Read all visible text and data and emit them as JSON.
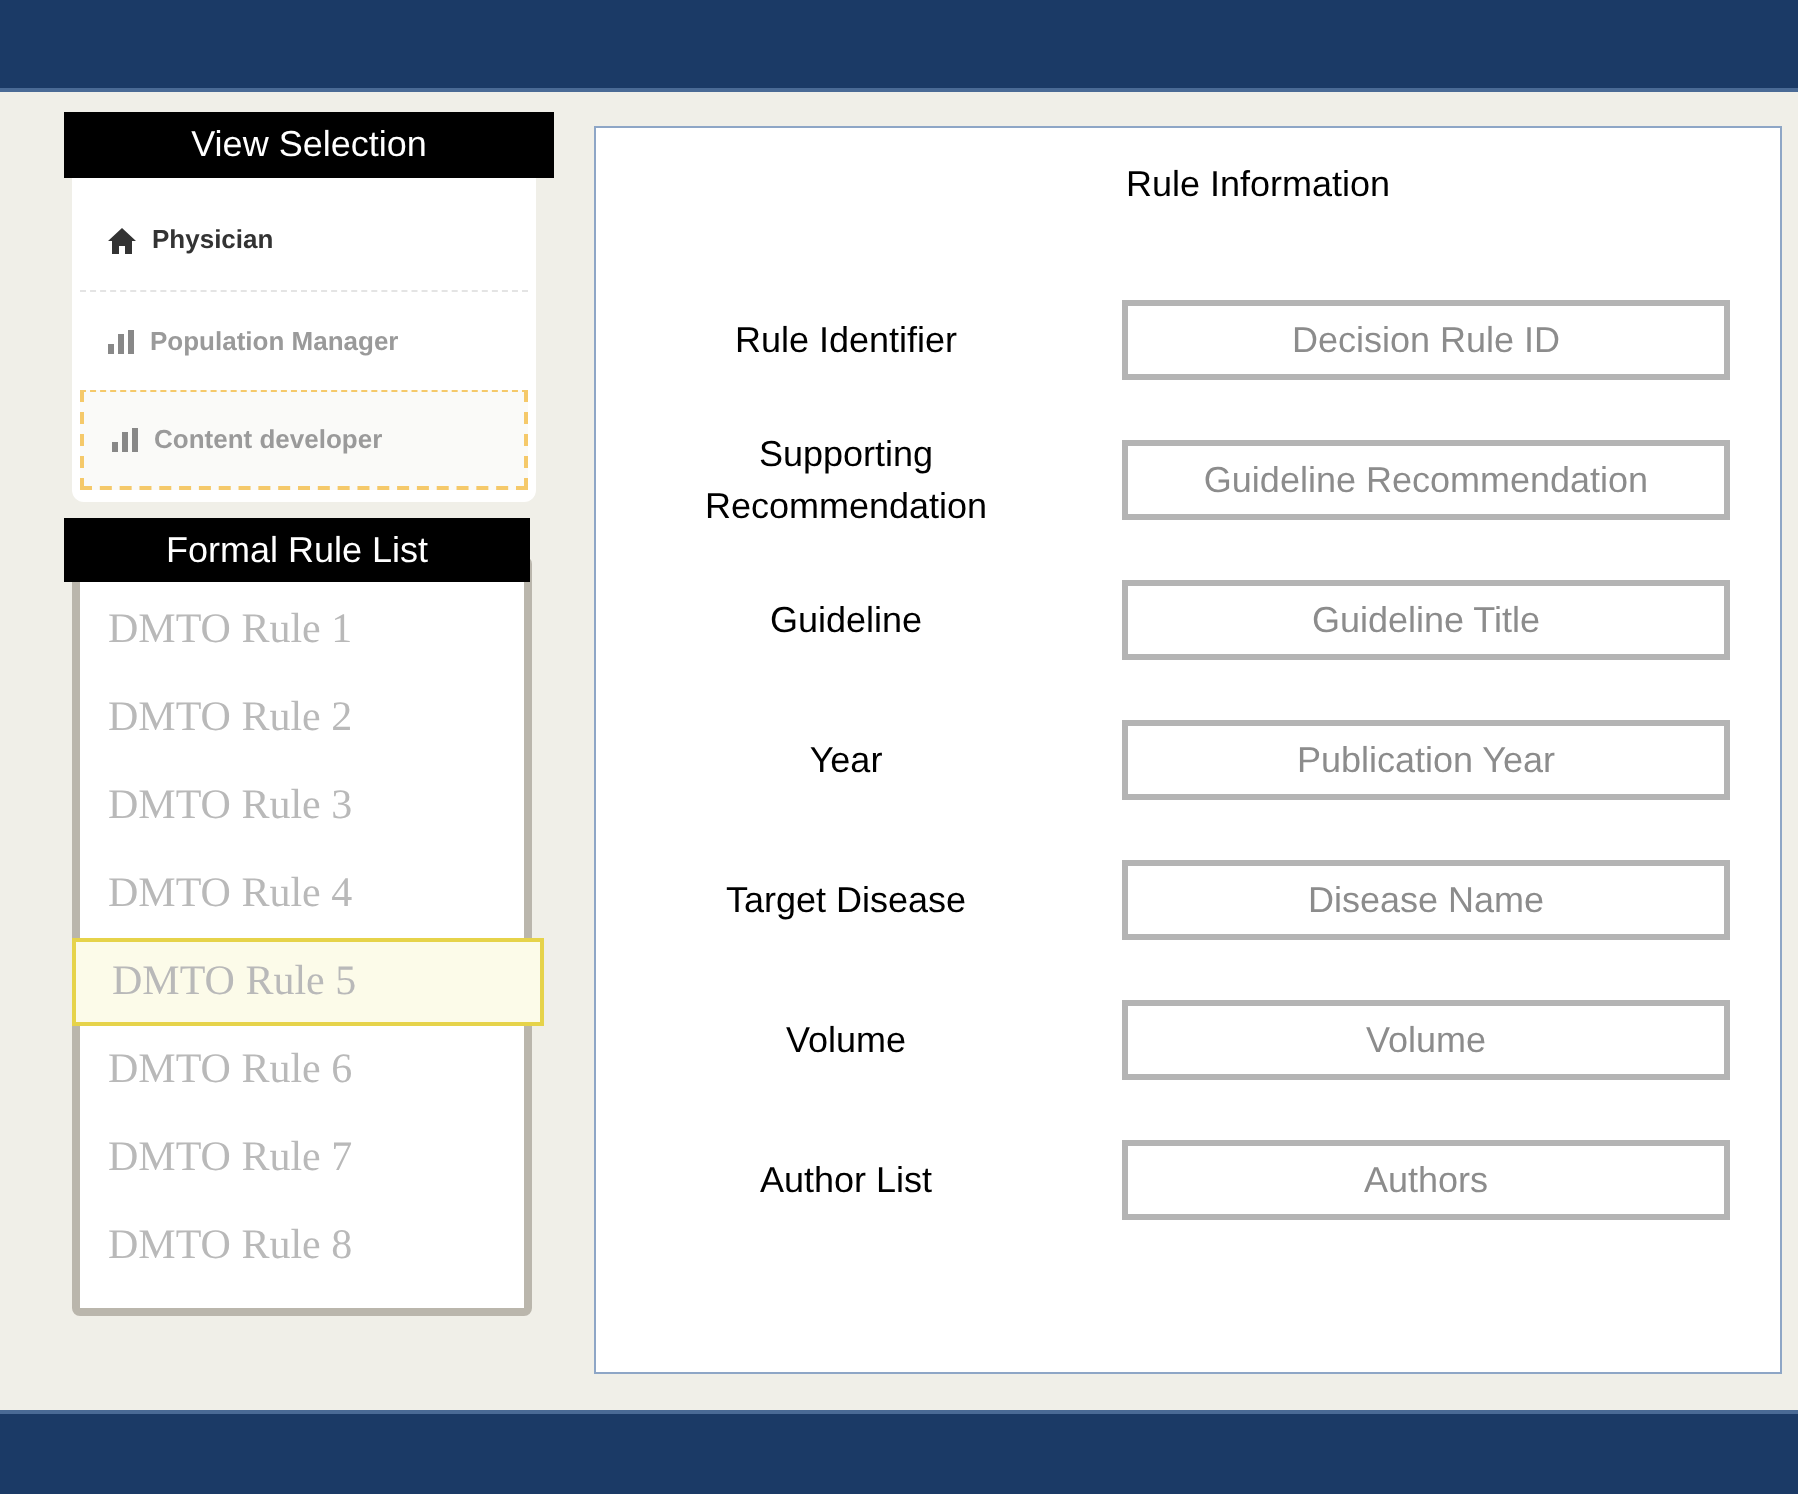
{
  "view_selection": {
    "title": "View Selection",
    "items": [
      {
        "label": "Physician",
        "kind": "home",
        "selected": false,
        "disabled": false
      },
      {
        "label": "Population Manager",
        "kind": "chart",
        "selected": false,
        "disabled": true
      },
      {
        "label": "Content developer",
        "kind": "chart",
        "selected": true,
        "disabled": true
      }
    ]
  },
  "rule_list": {
    "title": "Formal Rule List",
    "items": [
      {
        "label": "DMTO Rule 1",
        "selected": false
      },
      {
        "label": "DMTO Rule 2",
        "selected": false
      },
      {
        "label": "DMTO Rule 3",
        "selected": false
      },
      {
        "label": "DMTO Rule 4",
        "selected": false
      },
      {
        "label": "DMTO Rule 5",
        "selected": true
      },
      {
        "label": "DMTO Rule 6",
        "selected": false
      },
      {
        "label": "DMTO Rule 7",
        "selected": false
      },
      {
        "label": "DMTO Rule 8",
        "selected": false
      }
    ]
  },
  "rule_information": {
    "title": "Rule Information",
    "fields": [
      {
        "label": "Rule Identifier",
        "placeholder": "Decision Rule ID"
      },
      {
        "label": "Supporting Recommendation",
        "placeholder": "Guideline Recommendation"
      },
      {
        "label": "Guideline",
        "placeholder": "Guideline Title"
      },
      {
        "label": "Year",
        "placeholder": "Publication Year"
      },
      {
        "label": "Target Disease",
        "placeholder": "Disease Name"
      },
      {
        "label": "Volume",
        "placeholder": "Volume"
      },
      {
        "label": "Author List",
        "placeholder": "Authors"
      }
    ]
  }
}
